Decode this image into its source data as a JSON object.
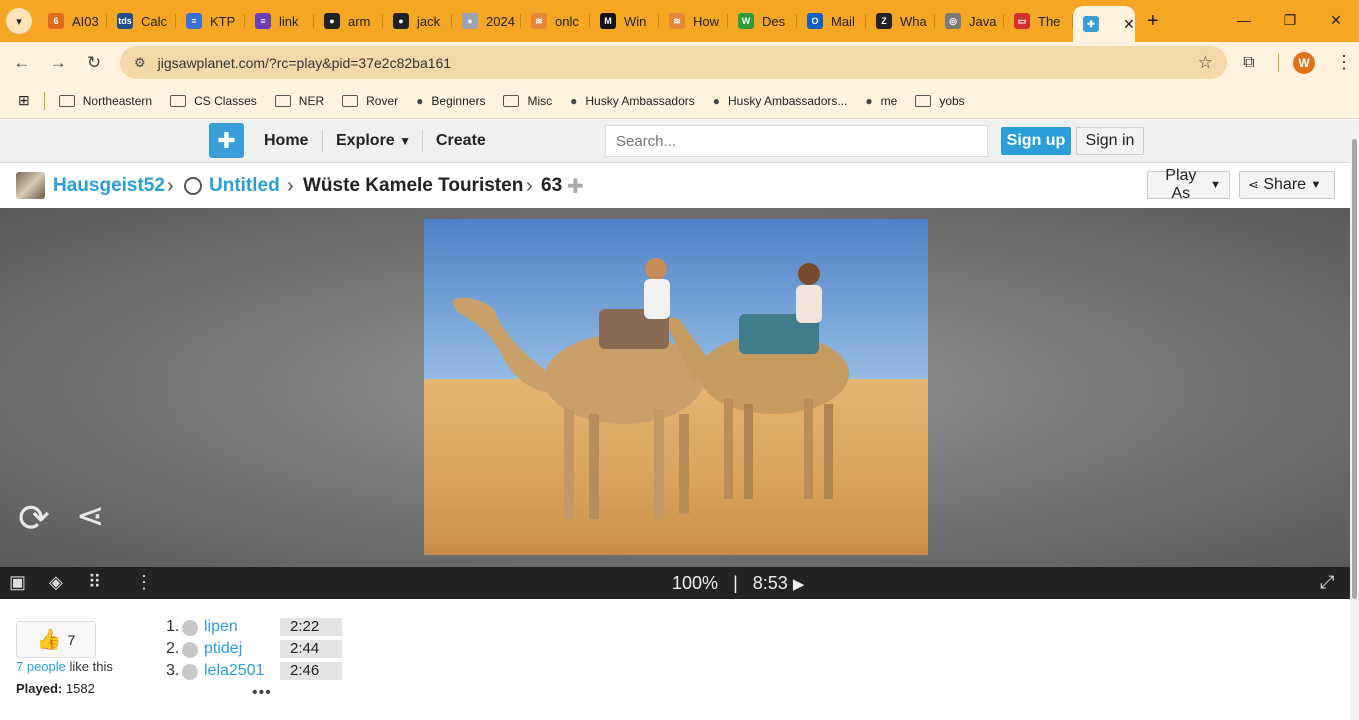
{
  "browser": {
    "tabs": [
      {
        "label": "AI03",
        "color": "#e06b1f",
        "glyph": "6"
      },
      {
        "label": "Calc",
        "color": "#1e4f8a",
        "glyph": "tds"
      },
      {
        "label": "KTP",
        "color": "#3a6fe0",
        "glyph": "≡"
      },
      {
        "label": "link",
        "color": "#6a3fb5",
        "glyph": "≡"
      },
      {
        "label": "arm",
        "color": "#222222",
        "glyph": "●"
      },
      {
        "label": "jack",
        "color": "#222222",
        "glyph": "●"
      },
      {
        "label": "2024",
        "color": "#9aa3b0",
        "glyph": "●"
      },
      {
        "label": "onlc",
        "color": "#e8873a",
        "glyph": "≋"
      },
      {
        "label": "Win",
        "color": "#111111",
        "glyph": "M"
      },
      {
        "label": "How",
        "color": "#e8873a",
        "glyph": "≋"
      },
      {
        "label": "Des",
        "color": "#2e9a3a",
        "glyph": "W"
      },
      {
        "label": "Mail",
        "color": "#1060c0",
        "glyph": "O"
      },
      {
        "label": "Wha",
        "color": "#222222",
        "glyph": "Z"
      },
      {
        "label": "Java",
        "color": "#7a7a7a",
        "glyph": "◎"
      },
      {
        "label": "The",
        "color": "#d32f2f",
        "glyph": "▭"
      }
    ],
    "active_tab": {
      "color": "#3a9fd9",
      "glyph": "✚",
      "close": "✕"
    },
    "new_tab": "+",
    "url": "jigsawplanet.com/?rc=play&pid=37e2c82ba161",
    "profile_initial": "W",
    "bookmarks": [
      {
        "label": "Northeastern",
        "type": "folder"
      },
      {
        "label": "CS Classes",
        "type": "folder"
      },
      {
        "label": "NER",
        "type": "folder"
      },
      {
        "label": "Rover",
        "type": "folder"
      },
      {
        "label": "Beginners",
        "type": "site",
        "icon": "github-icon"
      },
      {
        "label": "Misc",
        "type": "folder"
      },
      {
        "label": "Husky Ambassadors",
        "type": "site",
        "icon": "northeastern-icon"
      },
      {
        "label": "Husky Ambassadors...",
        "type": "site",
        "icon": "sheets-icon"
      },
      {
        "label": "me",
        "type": "site",
        "icon": "globe-icon"
      },
      {
        "label": "yobs",
        "type": "folder"
      }
    ]
  },
  "site": {
    "nav": {
      "home": "Home",
      "explore": "Explore",
      "create": "Create"
    },
    "search_placeholder": "Search...",
    "signup": "Sign up",
    "signin": "Sign in"
  },
  "breadcrumb": {
    "user": "Hausgeist52",
    "album": "Untitled",
    "puzzle_title": "Wüste Kamele Touristen",
    "pieces": "63",
    "play_as": "Play As",
    "share": "Share"
  },
  "player": {
    "completion": "100%",
    "separator": "|",
    "timer": "8:53",
    "play_icon": "▶"
  },
  "stats": {
    "like_count": "7",
    "likes_link": "7 people",
    "likes_suffix": " like this",
    "played_label": "Played:",
    "played_value": "1582",
    "more": "•••"
  },
  "leaderboard": [
    {
      "rank": "1.",
      "name": "lipen",
      "time": "2:22"
    },
    {
      "rank": "2.",
      "name": "ptidej",
      "time": "2:44"
    },
    {
      "rank": "3.",
      "name": "lela2501",
      "time": "2:46"
    }
  ]
}
